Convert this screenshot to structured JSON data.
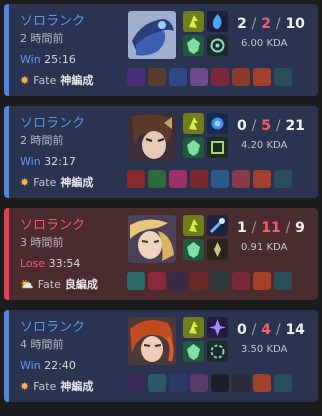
{
  "matches": [
    {
      "queue": "ソロランク",
      "ago": "2 時間前",
      "result": "Win",
      "duration": "25:16",
      "fate_prefix": "Fate",
      "fate_tier": "神編成",
      "weather": "sun",
      "kills": "2",
      "deaths": "2",
      "assists": "10",
      "kda_ratio": "6.00 KDA"
    },
    {
      "queue": "ソロランク",
      "ago": "2 時間前",
      "result": "Win",
      "duration": "32:17",
      "fate_prefix": "Fate",
      "fate_tier": "神編成",
      "weather": "sun",
      "kills": "0",
      "deaths": "5",
      "assists": "21",
      "kda_ratio": "4.20 KDA"
    },
    {
      "queue": "ソロランク",
      "ago": "3 時間前",
      "result": "Lose",
      "duration": "33:54",
      "fate_prefix": "Fate",
      "fate_tier": "良編成",
      "weather": "partly-cloudy",
      "kills": "1",
      "deaths": "11",
      "assists": "9",
      "kda_ratio": "0.91 KDA"
    },
    {
      "queue": "ソロランク",
      "ago": "4 時間前",
      "result": "Win",
      "duration": "22:40",
      "fate_prefix": "Fate",
      "fate_tier": "神編成",
      "weather": "sun",
      "kills": "0",
      "deaths": "4",
      "assists": "14",
      "kda_ratio": "3.50 KDA"
    }
  ],
  "colors": {
    "win": "#4f86e6",
    "loss": "#e84057",
    "win_bg": "#2a3350",
    "loss_bg": "#4a2b2e"
  }
}
